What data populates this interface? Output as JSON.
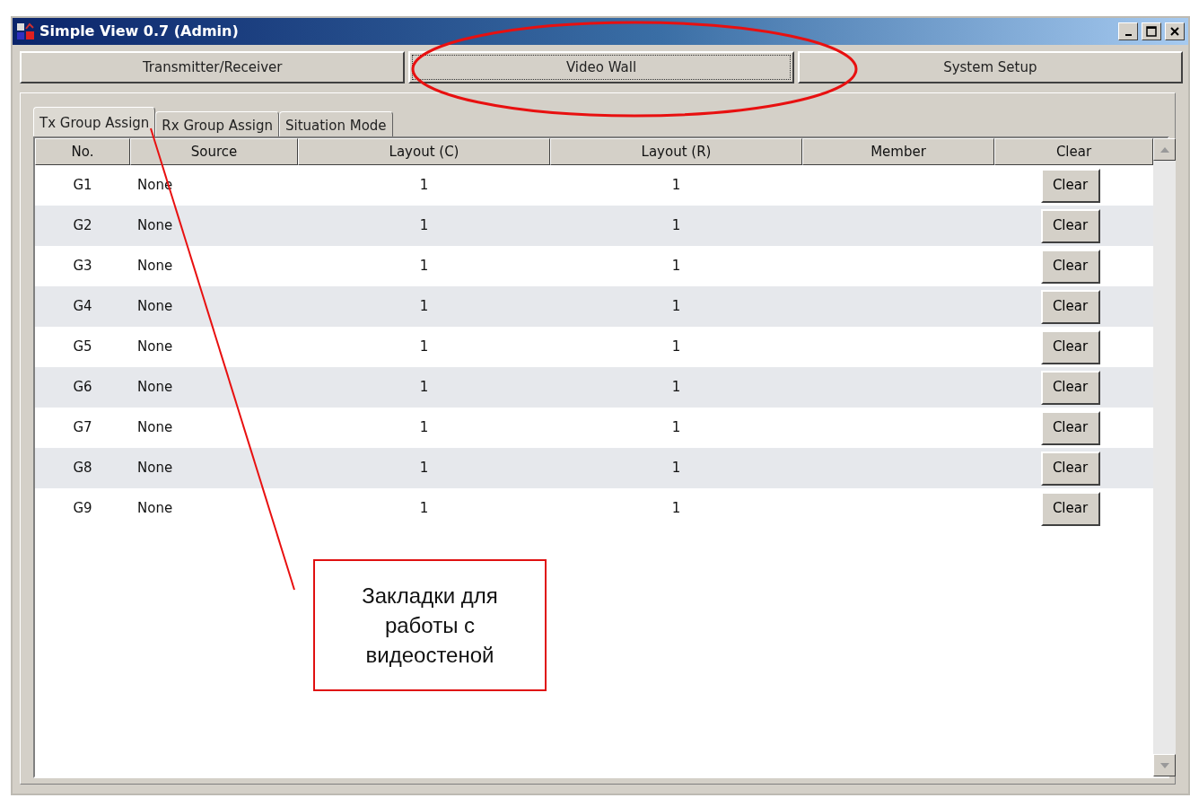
{
  "window": {
    "title": "Simple View 0.7 (Admin)"
  },
  "main_buttons": [
    {
      "label": "Transmitter/Receiver",
      "selected": false
    },
    {
      "label": "Video Wall",
      "selected": true
    },
    {
      "label": "System Setup",
      "selected": false
    }
  ],
  "tabs": [
    {
      "label": "Tx Group Assign",
      "selected": true
    },
    {
      "label": "Rx Group Assign",
      "selected": false
    },
    {
      "label": "Situation Mode",
      "selected": false
    }
  ],
  "table": {
    "columns": [
      "No.",
      "Source",
      "Layout (C)",
      "Layout (R)",
      "Member",
      "Clear"
    ],
    "rows": [
      {
        "no": "G1",
        "source": "None",
        "layout_c": "1",
        "layout_r": "1",
        "action": "Clear"
      },
      {
        "no": "G2",
        "source": "None",
        "layout_c": "1",
        "layout_r": "1",
        "action": "Clear"
      },
      {
        "no": "G3",
        "source": "None",
        "layout_c": "1",
        "layout_r": "1",
        "action": "Clear"
      },
      {
        "no": "G4",
        "source": "None",
        "layout_c": "1",
        "layout_r": "1",
        "action": "Clear"
      },
      {
        "no": "G5",
        "source": "None",
        "layout_c": "1",
        "layout_r": "1",
        "action": "Clear"
      },
      {
        "no": "G6",
        "source": "None",
        "layout_c": "1",
        "layout_r": "1",
        "action": "Clear"
      },
      {
        "no": "G7",
        "source": "None",
        "layout_c": "1",
        "layout_r": "1",
        "action": "Clear"
      },
      {
        "no": "G8",
        "source": "None",
        "layout_c": "1",
        "layout_r": "1",
        "action": "Clear"
      },
      {
        "no": "G9",
        "source": "None",
        "layout_c": "1",
        "layout_r": "1",
        "action": "Clear"
      }
    ]
  },
  "annotation": {
    "callout": "Закладки для работы с видеостеной"
  }
}
